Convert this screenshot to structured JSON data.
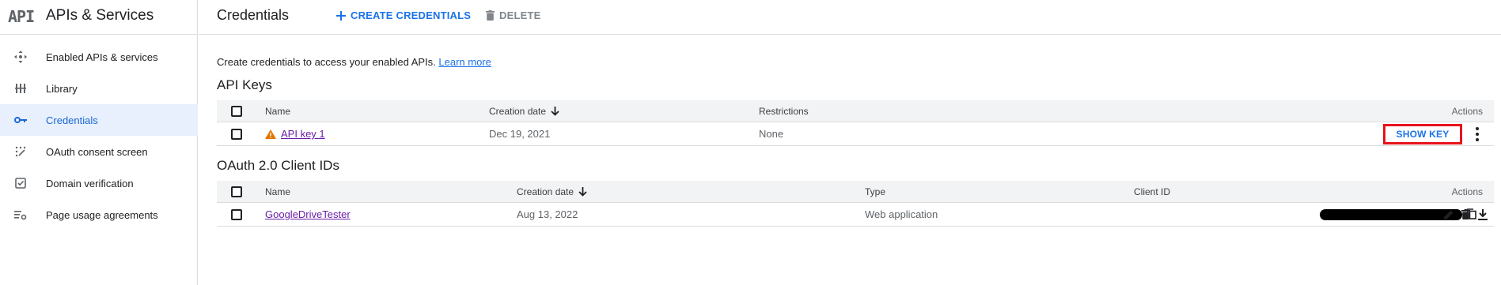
{
  "app": {
    "logo_text": "API",
    "title": "APIs & Services"
  },
  "sidebar": {
    "items": [
      {
        "label": "Enabled APIs & services",
        "icon": "move-icon",
        "active": false
      },
      {
        "label": "Library",
        "icon": "library-icon",
        "active": false
      },
      {
        "label": "Credentials",
        "icon": "key-icon",
        "active": true
      },
      {
        "label": "OAuth consent screen",
        "icon": "consent-icon",
        "active": false
      },
      {
        "label": "Domain verification",
        "icon": "checkbox-icon",
        "active": false
      },
      {
        "label": "Page usage agreements",
        "icon": "settings-list-icon",
        "active": false
      }
    ]
  },
  "header": {
    "title": "Credentials",
    "create_label": "CREATE CREDENTIALS",
    "delete_label": "DELETE"
  },
  "main": {
    "intro_text": "Create credentials to access your enabled APIs.",
    "learn_more": "Learn more"
  },
  "api_keys": {
    "title": "API Keys",
    "headers": {
      "name": "Name",
      "created": "Creation date",
      "restrictions": "Restrictions",
      "actions": "Actions"
    },
    "rows": [
      {
        "name": "API key 1",
        "created": "Dec 19, 2021",
        "restrictions": "None",
        "action": "SHOW KEY"
      }
    ]
  },
  "oauth": {
    "title": "OAuth 2.0 Client IDs",
    "headers": {
      "name": "Name",
      "created": "Creation date",
      "type": "Type",
      "client_id": "Client ID",
      "actions": "Actions"
    },
    "rows": [
      {
        "name": "GoogleDriveTester",
        "created": "Aug 13, 2022",
        "type": "Web application"
      }
    ]
  },
  "colors": {
    "accent": "#1a73e8",
    "link_visited": "#681da8",
    "warning": "#e37400",
    "highlight_box": "#e8131b",
    "active_bg": "#e8f0fe"
  }
}
